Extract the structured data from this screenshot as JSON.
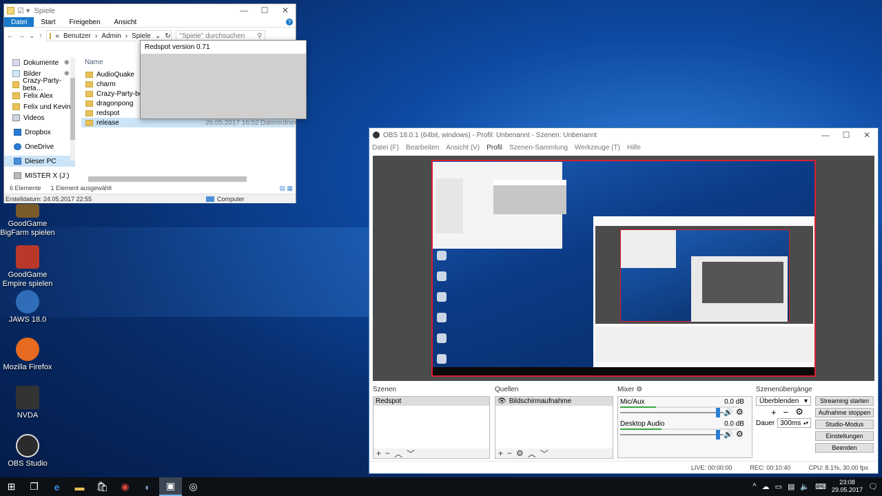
{
  "desktop": {
    "icons": [
      {
        "label": "GoodGame BigFarm spielen",
        "icon": "bigfarm-icon",
        "color": "#7a5a2a"
      },
      {
        "label": "GoodGame Empire spielen",
        "icon": "empire-icon",
        "color": "#b8392b"
      },
      {
        "label": "JAWS 18.0",
        "icon": "jaws-icon",
        "color": "#2f6db8"
      },
      {
        "label": "Mozilla Firefox",
        "icon": "firefox-icon",
        "color": "#e66a1f"
      },
      {
        "label": "NVDA",
        "icon": "nvda-icon",
        "color": "#333333"
      },
      {
        "label": "OBS Studio",
        "icon": "obs-icon",
        "color": "#2b2b2b"
      }
    ]
  },
  "explorer": {
    "title": "Spiele",
    "tabs": [
      "Datei",
      "Start",
      "Freigeben",
      "Ansicht"
    ],
    "breadcrumb": [
      "Benutzer",
      "Admin",
      "Spiele"
    ],
    "breadcrumb_prefix": "«",
    "search_placeholder": "\"Spiele\" durchsuchen",
    "nav": [
      "Dokumente",
      "Bilder",
      "Crazy-Party-beta…",
      "Felix Alex",
      "Felix und Kevin",
      "Videos",
      "Dropbox",
      "OneDrive",
      "Dieser PC",
      "MISTER X (J:)"
    ],
    "column_name": "Name",
    "files": [
      {
        "name": "AudioQuake",
        "date": "",
        "type": ""
      },
      {
        "name": "charm",
        "date": "",
        "type": ""
      },
      {
        "name": "Crazy-Party-beta49",
        "date": "",
        "type": ""
      },
      {
        "name": "dragonpong",
        "date": "",
        "type": ""
      },
      {
        "name": "redspot",
        "date": "",
        "type": ""
      },
      {
        "name": "release",
        "date": "26.05.2017 16:52",
        "type": "Dateiordner"
      }
    ],
    "status_count": "6 Elemente",
    "status_selected": "1 Element ausgewählt",
    "created": "Erstelldatum: 24.05.2017 22:55",
    "location": "Computer"
  },
  "popup": {
    "title": "Redspot version 0.71"
  },
  "obs": {
    "title": "OBS 18.0.1 (64bit, windows) - Profil: Unbenannt - Szenen: Unbenannt",
    "menu": [
      "Datei (F)",
      "Bearbeiten",
      "Ansicht (V)",
      "Profil",
      "Szenen-Sammlung",
      "Werkzeuge (T)",
      "Hilfe"
    ],
    "scenes_label": "Szenen",
    "scenes": [
      "Redspot"
    ],
    "sources_label": "Quellen",
    "sources": [
      "Bildschirmaufnahme"
    ],
    "mixer_label": "Mixer",
    "channels": [
      {
        "name": "Mic/Aux",
        "db": "0.0 dB",
        "level": 0.3
      },
      {
        "name": "Desktop Audio",
        "db": "0.0 dB",
        "level": 0.35
      }
    ],
    "transitions_label": "Szenenübergänge",
    "transition": "Überblenden",
    "duration_label": "Dauer",
    "duration": "300ms",
    "buttons": [
      "Streaming starten",
      "Aufnahme stoppen",
      "Studio-Modus",
      "Einstellungen",
      "Beenden"
    ],
    "live": "LIVE: 00:00:00",
    "rec": "REC: 00:10:40",
    "cpu": "CPU: 8.1%, 30.00 fps"
  },
  "taskbar": {
    "time": "23:08",
    "date": "29.05.2017"
  }
}
